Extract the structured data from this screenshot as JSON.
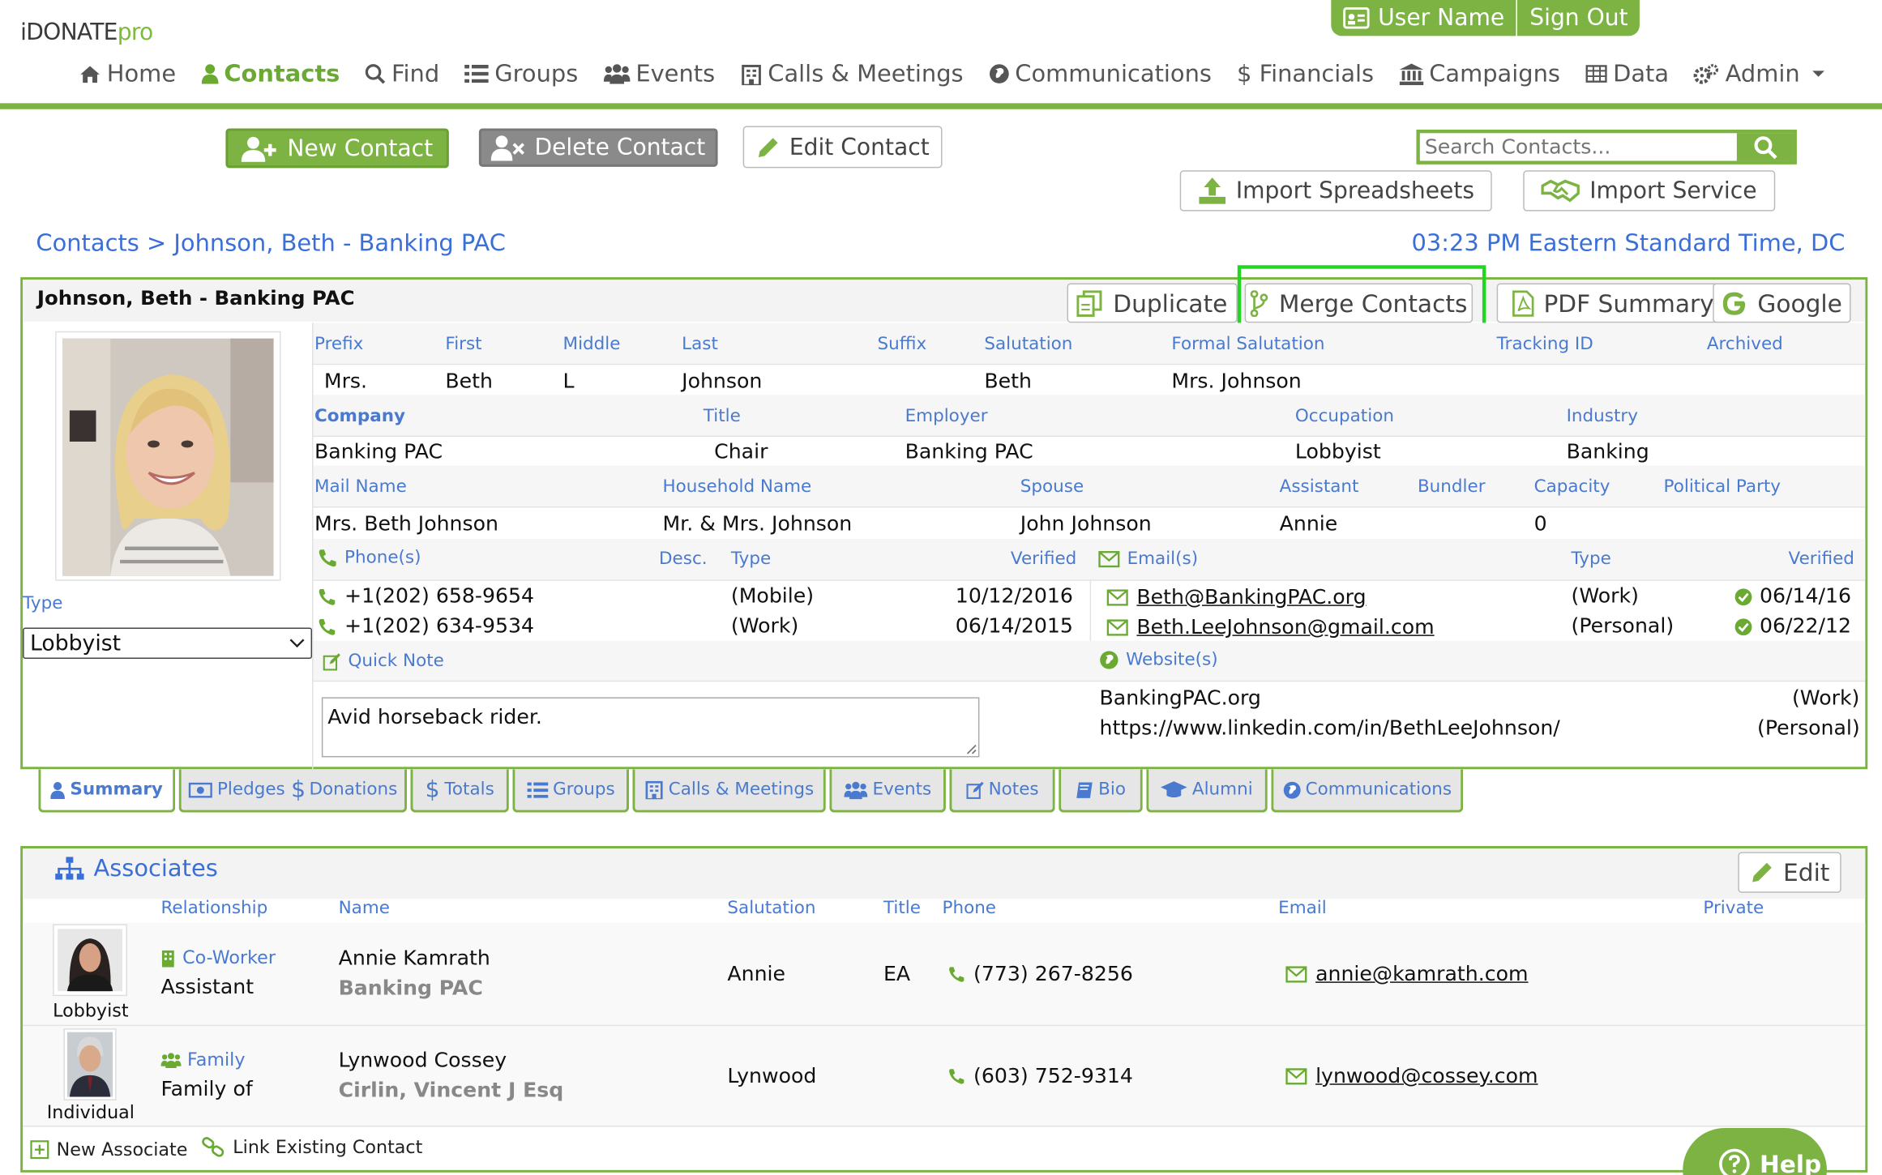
{
  "app": {
    "logo_main": "iDONATE",
    "logo_suffix": "pro"
  },
  "user_bar": {
    "user_label": "User Name",
    "signout_label": "Sign Out"
  },
  "nav": [
    {
      "label": "Home",
      "icon": "home-icon",
      "active": false
    },
    {
      "label": "Contacts",
      "icon": "user-icon",
      "active": true
    },
    {
      "label": "Find",
      "icon": "search-icon",
      "active": false
    },
    {
      "label": "Groups",
      "icon": "list-icon",
      "active": false
    },
    {
      "label": "Events",
      "icon": "users-icon",
      "active": false
    },
    {
      "label": "Calls & Meetings",
      "icon": "building-icon",
      "active": false
    },
    {
      "label": "Communications",
      "icon": "globe-icon",
      "active": false
    },
    {
      "label": "$ Financials",
      "icon": "",
      "active": false
    },
    {
      "label": "Campaigns",
      "icon": "bank-icon",
      "active": false
    },
    {
      "label": "Data",
      "icon": "table-icon",
      "active": false
    },
    {
      "label": "Admin",
      "icon": "gears-icon",
      "active": false
    }
  ],
  "actions": {
    "new_contact": "New Contact",
    "delete_contact": "Delete Contact",
    "edit_contact": "Edit Contact",
    "search_placeholder": "Search Contacts...",
    "import_spreadsheets": "Import Spreadsheets",
    "import_service": "Import Service"
  },
  "breadcrumb": {
    "root": "Contacts",
    "sep": ">",
    "current": "Johnson, Beth - Banking PAC"
  },
  "clock": "03:23 PM Eastern Standard Time, DC",
  "contact": {
    "title": "Johnson, Beth - Banking PAC",
    "buttons": {
      "duplicate": "Duplicate",
      "merge": "Merge Contacts",
      "pdf": "PDF Summary",
      "google": "Google"
    },
    "type_label": "Type",
    "type_value": "Lobbyist",
    "labels": {
      "prefix": "Prefix",
      "first": "First",
      "middle": "Middle",
      "last": "Last",
      "suffix": "Suffix",
      "salutation": "Salutation",
      "formal_salutation": "Formal Salutation",
      "tracking_id": "Tracking ID",
      "archived": "Archived",
      "company": "Company",
      "title": "Title",
      "employer": "Employer",
      "occupation": "Occupation",
      "industry": "Industry",
      "mail_name": "Mail Name",
      "household_name": "Household Name",
      "spouse": "Spouse",
      "assistant": "Assistant",
      "bundler": "Bundler",
      "capacity": "Capacity",
      "political_party": "Political Party",
      "phones": "Phone(s)",
      "desc": "Desc.",
      "type": "Type",
      "verified": "Verified",
      "emails": "Email(s)",
      "quick_note": "Quick Note",
      "websites": "Website(s)"
    },
    "values": {
      "prefix": "Mrs.",
      "first": "Beth",
      "middle": "L",
      "last": "Johnson",
      "salutation": "Beth",
      "formal_salutation": "Mrs. Johnson",
      "company": "Banking PAC",
      "title": "Chair",
      "employer": "Banking PAC",
      "occupation": "Lobbyist",
      "industry": "Banking",
      "mail_name": "Mrs. Beth Johnson",
      "household_name": "Mr. & Mrs. Johnson",
      "spouse": "John Johnson",
      "assistant": "Annie",
      "capacity": "0"
    },
    "phones": [
      {
        "number": "+1(202) 658-9654",
        "type": "(Mobile)",
        "verified": "10/12/2016"
      },
      {
        "number": "+1(202) 634-9534",
        "type": "(Work)",
        "verified": "06/14/2015"
      }
    ],
    "emails": [
      {
        "address": "Beth@BankingPAC.org",
        "type": "(Work)",
        "verified": "06/14/16"
      },
      {
        "address": "Beth.LeeJohnson@gmail.com",
        "type": "(Personal)",
        "verified": "06/22/12"
      }
    ],
    "quick_note": "Avid horseback rider.",
    "websites": [
      {
        "url": "BankingPAC.org",
        "type": "(Work)"
      },
      {
        "url": "https://www.linkedin.com/in/BethLeeJohnson/",
        "type": "(Personal)"
      }
    ]
  },
  "tabs": [
    {
      "label": "Summary",
      "icon": "user-icon"
    },
    {
      "label": "Pledges",
      "icon": "money-icon"
    },
    {
      "label": "Donations",
      "icon": "dollar-icon"
    },
    {
      "label": "Totals",
      "icon": "dollar-icon"
    },
    {
      "label": "Groups",
      "icon": "list-icon"
    },
    {
      "label": "Calls & Meetings",
      "icon": "building-icon"
    },
    {
      "label": "Events",
      "icon": "users-icon"
    },
    {
      "label": "Notes",
      "icon": "pencil-square-icon"
    },
    {
      "label": "Bio",
      "icon": "book-icon"
    },
    {
      "label": "Alumni",
      "icon": "graduation-cap-icon"
    },
    {
      "label": "Communications",
      "icon": "globe-icon"
    }
  ],
  "associates": {
    "title": "Associates",
    "edit": "Edit",
    "headers": {
      "relationship": "Relationship",
      "name": "Name",
      "salutation": "Salutation",
      "title": "Title",
      "phone": "Phone",
      "email": "Email",
      "private": "Private"
    },
    "rows": [
      {
        "type": "Lobbyist",
        "rel_kind": "Co-Worker",
        "rel_label": "Assistant",
        "name": "Annie Kamrath",
        "org": "Banking PAC",
        "salutation": "Annie",
        "title": "EA",
        "phone": "(773) 267-8256",
        "email": "annie@kamrath.com"
      },
      {
        "type": "Individual",
        "rel_kind": "Family",
        "rel_label": "Family of",
        "name": "Lynwood Cossey",
        "org": "Cirlin, Vincent J Esq",
        "salutation": "Lynwood",
        "title": "",
        "phone": "(603) 752-9314",
        "email": "lynwood@cossey.com"
      }
    ],
    "new_associate": "New Associate",
    "link_existing": "Link Existing Contact"
  },
  "help": "Help",
  "colors": {
    "brand_green": "#7cb342",
    "link_blue": "#3a6fd8",
    "highlight": "#22d622"
  }
}
